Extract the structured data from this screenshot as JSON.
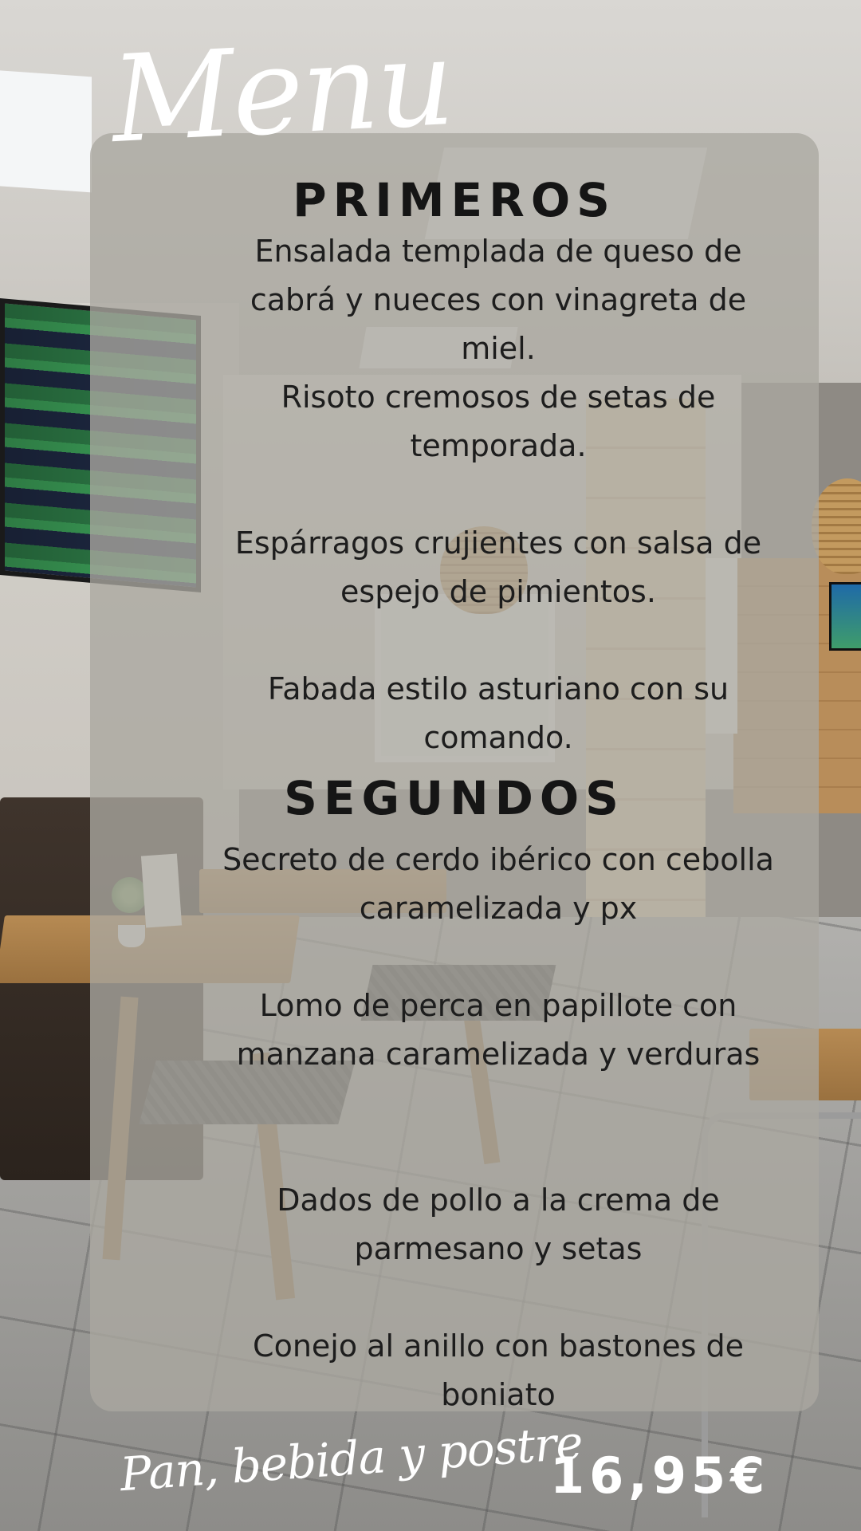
{
  "title": "Menu",
  "sections": [
    {
      "heading": "PRIMEROS",
      "items": [
        "Ensalada templada de queso de cabrá y nueces con vinagreta de miel.",
        "Risoto cremosos de setas de temporada.",
        "Espárragos crujientes con salsa de espejo de pimientos.",
        "Fabada estilo asturiano con su comando."
      ]
    },
    {
      "heading": "SEGUNDOS",
      "items": [
        "Secreto de cerdo ibérico con cebolla caramelizada y px",
        "Lomo de perca en papillote con manzana caramelizada y verduras",
        "Dados de pollo a la crema de parmesano y setas",
        "Conejo al anillo con bastones de boniato"
      ]
    }
  ],
  "footer": {
    "includes": "Pan, bebida y postre",
    "price": "16,95€"
  }
}
